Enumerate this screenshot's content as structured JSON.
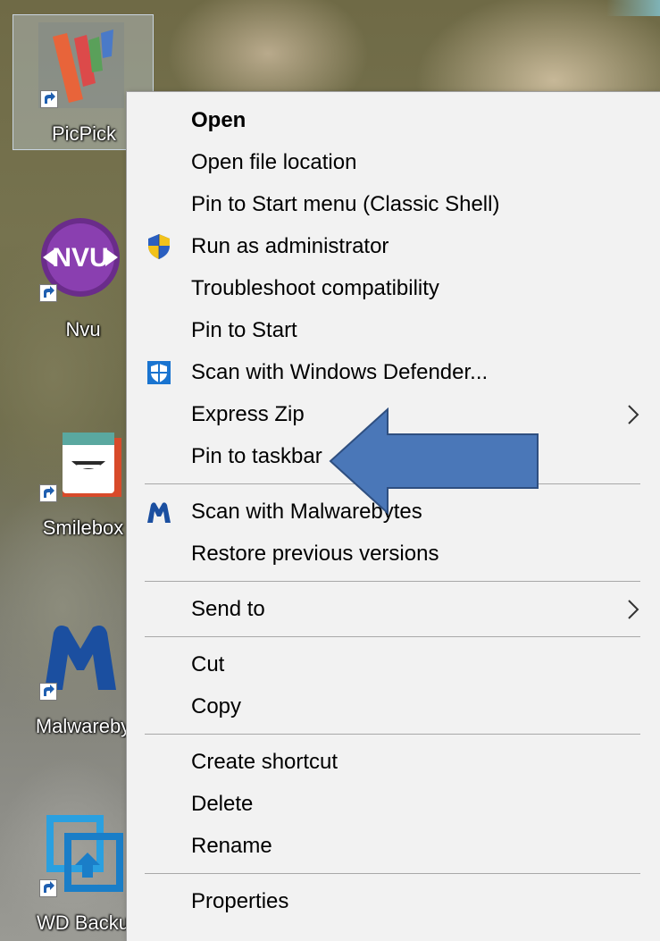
{
  "desktop": {
    "icons": [
      {
        "label": "PicPick",
        "icon": "picpick-icon"
      },
      {
        "label": "Nvu",
        "icon": "nvu-icon",
        "badge": "NVU"
      },
      {
        "label": "Smilebox",
        "icon": "smilebox-icon"
      },
      {
        "label": "Malwareby",
        "icon": "malwarebytes-icon"
      },
      {
        "label": "WD Backu",
        "icon": "wd-backup-icon"
      }
    ]
  },
  "context_menu": {
    "items": [
      {
        "label": "Open",
        "bold": true
      },
      {
        "label": "Open file location"
      },
      {
        "label": "Pin to Start menu (Classic Shell)"
      },
      {
        "label": "Run as administrator",
        "icon": "uac-shield-icon"
      },
      {
        "label": "Troubleshoot compatibility"
      },
      {
        "label": "Pin to Start"
      },
      {
        "label": "Scan with Windows Defender...",
        "icon": "windows-defender-icon"
      },
      {
        "label": "Express Zip",
        "submenu": true
      },
      {
        "label": "Pin to taskbar"
      },
      {
        "label": "Scan with Malwarebytes",
        "icon": "malwarebytes-icon"
      },
      {
        "label": "Restore previous versions"
      },
      {
        "label": "Send to",
        "submenu": true
      },
      {
        "label": "Cut"
      },
      {
        "label": "Copy"
      },
      {
        "label": "Create shortcut"
      },
      {
        "label": "Delete"
      },
      {
        "label": "Rename"
      },
      {
        "label": "Properties"
      }
    ]
  },
  "annotation": {
    "arrow_color": "#4a77b8",
    "points_to": "Pin to taskbar"
  },
  "colors": {
    "menu_bg": "#f2f2f2",
    "menu_border": "#a0a0a0",
    "separator": "#a8a8a8"
  }
}
